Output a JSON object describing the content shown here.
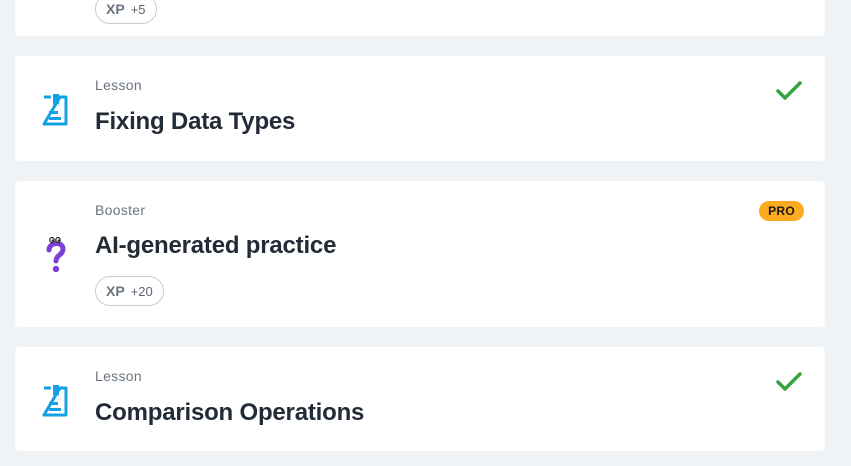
{
  "items": [
    {
      "type": "",
      "title": "",
      "xp_label": "XP",
      "xp_value": "+5"
    },
    {
      "type": "Lesson",
      "title": "Fixing Data Types",
      "icon": "lesson-document-icon",
      "status": "completed",
      "status_icon": "checkmark-icon"
    },
    {
      "type": "Booster",
      "title": "AI-generated practice",
      "icon": "question-mark-character-icon",
      "badge": "PRO",
      "xp_label": "XP",
      "xp_value": "+20"
    },
    {
      "type": "Lesson",
      "title": "Comparison Operations",
      "icon": "lesson-document-icon",
      "status": "completed",
      "status_icon": "checkmark-icon"
    }
  ],
  "colors": {
    "background": "#f0f3f6",
    "card": "#ffffff",
    "lesson_icon": "#13a1e6",
    "booster_icon": "#7d3fd6",
    "check": "#35a33f",
    "pro_badge": "#fcab1e",
    "title_text": "#222b36",
    "label_text": "#6b7480"
  }
}
